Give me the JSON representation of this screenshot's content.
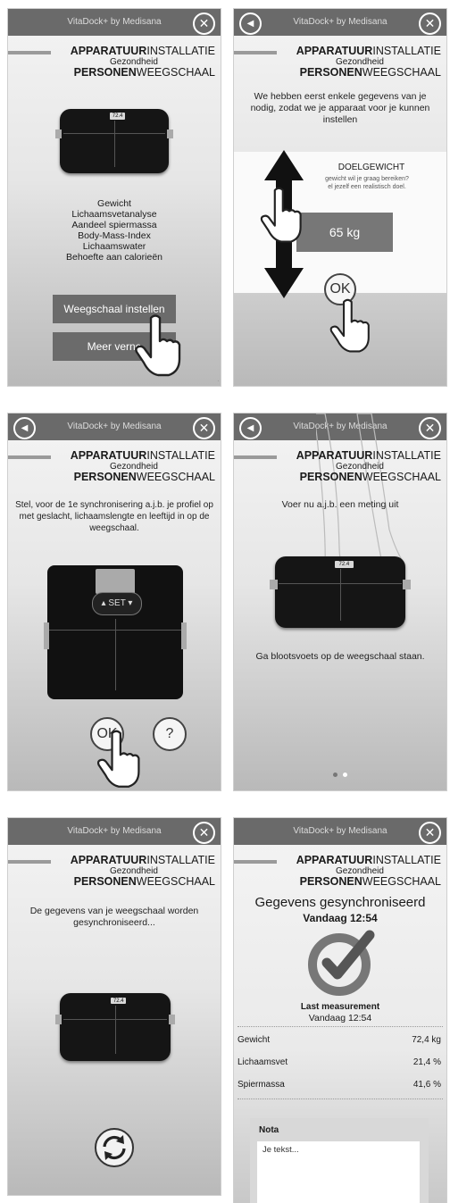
{
  "app_title": "VitaDock+ by Medisana",
  "header": {
    "l1_bold": "APPARATUUR",
    "l1": "INSTALLATIE",
    "l2": "Gezondheid",
    "l3_bold": "PERSONEN",
    "l3": "WEEGSCHAAL"
  },
  "icons": {
    "close": "close-icon",
    "back": "back-arrow-icon",
    "hand": "pointing-hand-icon",
    "sync": "sync-icon",
    "check": "checkmark-icon"
  },
  "scale_display": "72.4",
  "scale_brand": "Medisana",
  "screen1": {
    "features": [
      "Gewicht",
      "Lichaamsvetanalyse",
      "Aandeel spiermassa",
      "Body-Mass-Index",
      "Lichaamswater",
      "Behoefte aan calorieën"
    ],
    "primary_button": "Weegschaal instellen",
    "secondary_button": "Meer verne"
  },
  "screen2": {
    "intro": "We hebben eerst enkele gegevens van je nodig, zodat we je apparaat voor je kunnen instellen",
    "card_title": "DOELGEWICHT",
    "card_hint_1": "gewicht wil je graag bereiken?",
    "card_hint_2": "el jezelf een realistisch doel.",
    "value": "65 kg",
    "ok": "OK"
  },
  "screen3": {
    "instruction": "Stel, voor de 1e synchronisering a.j.b. je profiel op met geslacht, lichaamslengte en leeftijd in op de weegschaal.",
    "set_label": "SET",
    "ok": "OK",
    "help": "?"
  },
  "screen4": {
    "instruction": "Voer nu a.j.b. een meting uit",
    "caption": "Ga blootsvoets op de weegschaal staan.",
    "pager": {
      "count": 2,
      "active": 1
    }
  },
  "screen5": {
    "text": "De gegevens van je weegschaal worden gesynchroniseerd..."
  },
  "screen6": {
    "title": "Gegevens gesynchroniseerd",
    "time": "Vandaag 12:54",
    "last_label": "Last measurement",
    "last_time": "Vandaag 12:54",
    "rows": [
      {
        "label": "Gewicht",
        "value": "72,4 kg"
      },
      {
        "label": "Lichaamsvet",
        "value": "21,4 %"
      },
      {
        "label": "Spiermassa",
        "value": "41,6 %"
      }
    ],
    "note_label": "Nota",
    "note_placeholder": "Je tekst..."
  }
}
